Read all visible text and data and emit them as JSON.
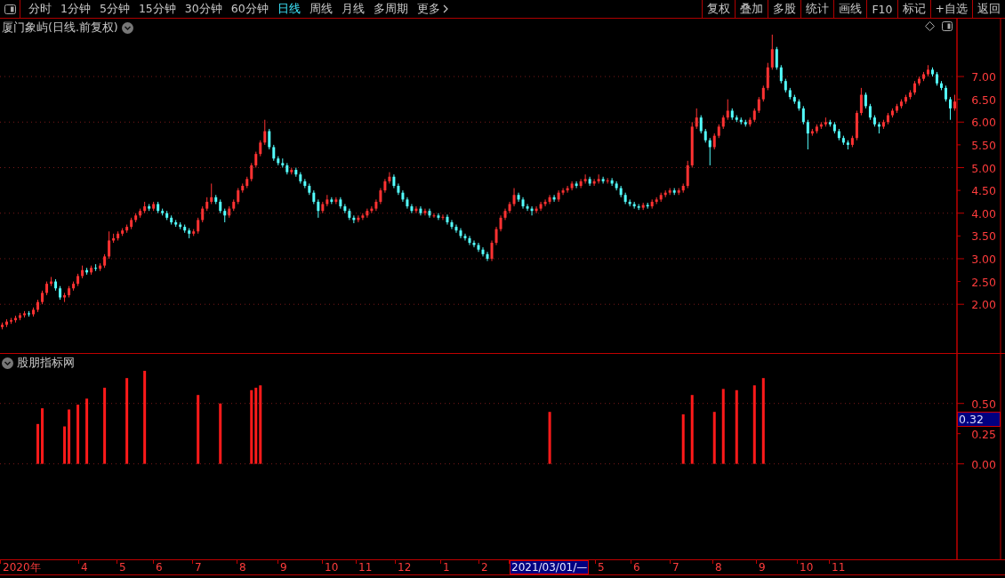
{
  "toolbar": {
    "periods": [
      {
        "label": "分时",
        "selected": false
      },
      {
        "label": "1分钟",
        "selected": false
      },
      {
        "label": "5分钟",
        "selected": false
      },
      {
        "label": "15分钟",
        "selected": false
      },
      {
        "label": "30分钟",
        "selected": false
      },
      {
        "label": "60分钟",
        "selected": false
      },
      {
        "label": "日线",
        "selected": true
      },
      {
        "label": "周线",
        "selected": false
      },
      {
        "label": "月线",
        "selected": false
      },
      {
        "label": "多周期",
        "selected": false
      },
      {
        "label": "更多",
        "selected": false
      }
    ],
    "buttons": [
      "复权",
      "叠加",
      "多股",
      "统计",
      "画线",
      "F10",
      "标记",
      "+自选",
      "返回"
    ]
  },
  "price_panel": {
    "title": "厦门象屿(日线.前复权)",
    "chart_data": {
      "type": "candlestick",
      "ylim": [
        0.93,
        8.27
      ],
      "grid": true,
      "yticks": [
        {
          "value": 7,
          "label": "7.00"
        },
        {
          "value": 6.5,
          "label": "6.50"
        },
        {
          "value": 6,
          "label": "6.00"
        },
        {
          "value": 5.5,
          "label": "5.50"
        },
        {
          "value": 5,
          "label": "5.00"
        },
        {
          "value": 4.5,
          "label": "4.50"
        },
        {
          "value": 4,
          "label": "4.00"
        },
        {
          "value": 3.5,
          "label": "3.50"
        },
        {
          "value": 3,
          "label": "3.00"
        },
        {
          "value": 2.5,
          "label": "2.50"
        },
        {
          "value": 2,
          "label": "2.00"
        }
      ],
      "ohlc": [
        [
          1.5,
          1.6,
          1.45,
          1.55
        ],
        [
          1.55,
          1.67,
          1.5,
          1.62
        ],
        [
          1.62,
          1.7,
          1.57,
          1.65
        ],
        [
          1.65,
          1.75,
          1.6,
          1.7
        ],
        [
          1.7,
          1.81,
          1.65,
          1.76
        ],
        [
          1.76,
          1.85,
          1.71,
          1.8
        ],
        [
          1.8,
          1.85,
          1.73,
          1.78
        ],
        [
          1.78,
          1.93,
          1.73,
          1.88
        ],
        [
          1.88,
          2.1,
          1.83,
          2.05
        ],
        [
          2.05,
          2.3,
          2.0,
          2.25
        ],
        [
          2.25,
          2.5,
          2.2,
          2.45
        ],
        [
          2.45,
          2.6,
          2.4,
          2.5
        ],
        [
          2.5,
          2.55,
          2.3,
          2.35
        ],
        [
          2.35,
          2.4,
          2.1,
          2.15
        ],
        [
          2.15,
          2.25,
          2.05,
          2.2
        ],
        [
          2.2,
          2.4,
          2.15,
          2.35
        ],
        [
          2.35,
          2.5,
          2.3,
          2.45
        ],
        [
          2.45,
          2.67,
          2.4,
          2.62
        ],
        [
          2.62,
          2.85,
          2.57,
          2.75
        ],
        [
          2.75,
          2.8,
          2.65,
          2.7
        ],
        [
          2.7,
          2.85,
          2.65,
          2.8
        ],
        [
          2.8,
          2.88,
          2.73,
          2.78
        ],
        [
          2.78,
          2.9,
          2.73,
          2.85
        ],
        [
          2.85,
          3.1,
          2.8,
          3.05
        ],
        [
          3.05,
          3.6,
          3.0,
          3.4
        ],
        [
          3.4,
          3.55,
          3.35,
          3.45
        ],
        [
          3.45,
          3.6,
          3.4,
          3.55
        ],
        [
          3.55,
          3.67,
          3.5,
          3.62
        ],
        [
          3.62,
          3.75,
          3.57,
          3.7
        ],
        [
          3.7,
          3.9,
          3.65,
          3.85
        ],
        [
          3.85,
          4.0,
          3.8,
          3.95
        ],
        [
          3.95,
          4.1,
          3.9,
          4.05
        ],
        [
          4.05,
          4.25,
          4.0,
          4.15
        ],
        [
          4.15,
          4.2,
          4.05,
          4.1
        ],
        [
          4.1,
          4.25,
          4.05,
          4.2
        ],
        [
          4.2,
          4.25,
          4.0,
          4.05
        ],
        [
          4.05,
          4.1,
          3.95,
          4.0
        ],
        [
          4.0,
          4.05,
          3.85,
          3.9
        ],
        [
          3.9,
          3.95,
          3.75,
          3.8
        ],
        [
          3.8,
          3.85,
          3.7,
          3.75
        ],
        [
          3.75,
          3.8,
          3.65,
          3.7
        ],
        [
          3.7,
          3.75,
          3.57,
          3.62
        ],
        [
          3.62,
          3.67,
          3.45,
          3.55
        ],
        [
          3.55,
          3.65,
          3.5,
          3.6
        ],
        [
          3.6,
          3.9,
          3.55,
          3.85
        ],
        [
          3.85,
          4.15,
          3.8,
          4.1
        ],
        [
          4.1,
          4.35,
          4.05,
          4.25
        ],
        [
          4.25,
          4.65,
          4.2,
          4.35
        ],
        [
          4.35,
          4.4,
          4.2,
          4.25
        ],
        [
          4.25,
          4.3,
          4.0,
          4.05
        ],
        [
          4.05,
          4.1,
          3.8,
          3.95
        ],
        [
          3.95,
          4.15,
          3.9,
          4.1
        ],
        [
          4.1,
          4.3,
          4.05,
          4.25
        ],
        [
          4.25,
          4.55,
          4.2,
          4.5
        ],
        [
          4.5,
          4.65,
          4.45,
          4.6
        ],
        [
          4.6,
          4.8,
          4.55,
          4.75
        ],
        [
          4.75,
          5.1,
          4.7,
          5.05
        ],
        [
          5.05,
          5.35,
          5.0,
          5.3
        ],
        [
          5.3,
          5.6,
          5.25,
          5.55
        ],
        [
          5.55,
          6.05,
          5.5,
          5.8
        ],
        [
          5.8,
          5.85,
          5.4,
          5.45
        ],
        [
          5.45,
          5.5,
          5.15,
          5.2
        ],
        [
          5.2,
          5.25,
          5.05,
          5.1
        ],
        [
          5.1,
          5.2,
          5.0,
          5.05
        ],
        [
          5.05,
          5.1,
          4.85,
          4.9
        ],
        [
          4.9,
          5.0,
          4.85,
          4.95
        ],
        [
          4.95,
          5.0,
          4.8,
          4.85
        ],
        [
          4.85,
          4.9,
          4.65,
          4.7
        ],
        [
          4.7,
          4.75,
          4.55,
          4.6
        ],
        [
          4.6,
          4.65,
          4.4,
          4.45
        ],
        [
          4.45,
          4.5,
          4.2,
          4.25
        ],
        [
          4.25,
          4.3,
          3.9,
          4.05
        ],
        [
          4.05,
          4.25,
          4.0,
          4.2
        ],
        [
          4.2,
          4.4,
          4.15,
          4.3
        ],
        [
          4.3,
          4.35,
          4.2,
          4.25
        ],
        [
          4.25,
          4.35,
          4.2,
          4.3
        ],
        [
          4.3,
          4.35,
          4.1,
          4.15
        ],
        [
          4.15,
          4.2,
          4.0,
          4.05
        ],
        [
          4.05,
          4.1,
          3.85,
          3.9
        ],
        [
          3.9,
          3.95,
          3.78,
          3.85
        ],
        [
          3.85,
          3.95,
          3.8,
          3.9
        ],
        [
          3.9,
          4.0,
          3.85,
          3.95
        ],
        [
          3.95,
          4.1,
          3.9,
          4.05
        ],
        [
          4.05,
          4.15,
          4.0,
          4.1
        ],
        [
          4.1,
          4.3,
          4.05,
          4.25
        ],
        [
          4.25,
          4.55,
          4.2,
          4.5
        ],
        [
          4.5,
          4.75,
          4.45,
          4.7
        ],
        [
          4.7,
          4.9,
          4.65,
          4.8
        ],
        [
          4.8,
          4.85,
          4.55,
          4.6
        ],
        [
          4.6,
          4.65,
          4.4,
          4.45
        ],
        [
          4.45,
          4.5,
          4.25,
          4.3
        ],
        [
          4.3,
          4.35,
          4.1,
          4.15
        ],
        [
          4.15,
          4.2,
          4.0,
          4.05
        ],
        [
          4.05,
          4.15,
          4.0,
          4.1
        ],
        [
          4.1,
          4.15,
          3.95,
          4.0
        ],
        [
          4.0,
          4.1,
          3.95,
          4.05
        ],
        [
          4.05,
          4.1,
          3.9,
          3.95
        ],
        [
          3.95,
          4.0,
          3.9,
          3.95
        ],
        [
          3.95,
          4.0,
          3.85,
          3.9
        ],
        [
          3.9,
          3.97,
          3.85,
          3.92
        ],
        [
          3.92,
          3.97,
          3.75,
          3.8
        ],
        [
          3.8,
          3.85,
          3.65,
          3.7
        ],
        [
          3.7,
          3.75,
          3.57,
          3.62
        ],
        [
          3.62,
          3.67,
          3.45,
          3.5
        ],
        [
          3.5,
          3.55,
          3.4,
          3.45
        ],
        [
          3.45,
          3.5,
          3.3,
          3.35
        ],
        [
          3.35,
          3.4,
          3.25,
          3.3
        ],
        [
          3.3,
          3.35,
          3.15,
          3.2
        ],
        [
          3.2,
          3.25,
          3.05,
          3.1
        ],
        [
          3.1,
          3.15,
          2.95,
          3.0
        ],
        [
          3.0,
          3.4,
          2.95,
          3.35
        ],
        [
          3.35,
          3.7,
          3.3,
          3.65
        ],
        [
          3.65,
          3.95,
          3.6,
          3.9
        ],
        [
          3.9,
          4.1,
          3.85,
          4.05
        ],
        [
          4.05,
          4.25,
          4.0,
          4.2
        ],
        [
          4.2,
          4.55,
          4.15,
          4.4
        ],
        [
          4.4,
          4.45,
          4.25,
          4.3
        ],
        [
          4.3,
          4.35,
          4.1,
          4.15
        ],
        [
          4.15,
          4.2,
          4.05,
          4.1
        ],
        [
          4.1,
          4.15,
          3.95,
          4.05
        ],
        [
          4.05,
          4.15,
          4.0,
          4.1
        ],
        [
          4.1,
          4.25,
          4.05,
          4.2
        ],
        [
          4.2,
          4.3,
          4.15,
          4.25
        ],
        [
          4.25,
          4.4,
          4.2,
          4.35
        ],
        [
          4.35,
          4.4,
          4.25,
          4.3
        ],
        [
          4.3,
          4.5,
          4.25,
          4.45
        ],
        [
          4.45,
          4.55,
          4.4,
          4.5
        ],
        [
          4.5,
          4.6,
          4.45,
          4.55
        ],
        [
          4.55,
          4.7,
          4.5,
          4.65
        ],
        [
          4.65,
          4.7,
          4.55,
          4.6
        ],
        [
          4.6,
          4.75,
          4.55,
          4.7
        ],
        [
          4.7,
          4.85,
          4.65,
          4.75
        ],
        [
          4.75,
          4.8,
          4.6,
          4.65
        ],
        [
          4.65,
          4.75,
          4.6,
          4.7
        ],
        [
          4.7,
          4.85,
          4.65,
          4.75
        ],
        [
          4.75,
          4.8,
          4.65,
          4.7
        ],
        [
          4.7,
          4.77,
          4.65,
          4.72
        ],
        [
          4.72,
          4.77,
          4.6,
          4.65
        ],
        [
          4.65,
          4.7,
          4.5,
          4.55
        ],
        [
          4.55,
          4.6,
          4.35,
          4.4
        ],
        [
          4.4,
          4.45,
          4.2,
          4.25
        ],
        [
          4.25,
          4.3,
          4.15,
          4.2
        ],
        [
          4.2,
          4.25,
          4.1,
          4.15
        ],
        [
          4.15,
          4.2,
          4.07,
          4.12
        ],
        [
          4.12,
          4.23,
          4.07,
          4.18
        ],
        [
          4.18,
          4.23,
          4.1,
          4.15
        ],
        [
          4.15,
          4.3,
          4.1,
          4.25
        ],
        [
          4.25,
          4.35,
          4.2,
          4.3
        ],
        [
          4.3,
          4.45,
          4.25,
          4.4
        ],
        [
          4.4,
          4.5,
          4.35,
          4.45
        ],
        [
          4.45,
          4.55,
          4.4,
          4.5
        ],
        [
          4.5,
          4.55,
          4.4,
          4.45
        ],
        [
          4.45,
          4.55,
          4.4,
          4.5
        ],
        [
          4.5,
          4.65,
          4.45,
          4.6
        ],
        [
          4.6,
          5.15,
          4.55,
          5.05
        ],
        [
          5.05,
          6.0,
          5.0,
          5.9
        ],
        [
          5.9,
          6.3,
          5.85,
          6.1
        ],
        [
          6.1,
          6.15,
          5.75,
          5.8
        ],
        [
          5.8,
          5.85,
          5.55,
          5.6
        ],
        [
          5.6,
          5.65,
          5.05,
          5.45
        ],
        [
          5.45,
          5.75,
          5.4,
          5.7
        ],
        [
          5.7,
          5.95,
          5.65,
          5.9
        ],
        [
          5.9,
          6.15,
          5.85,
          6.1
        ],
        [
          6.1,
          6.5,
          6.05,
          6.25
        ],
        [
          6.25,
          6.3,
          6.05,
          6.1
        ],
        [
          6.1,
          6.15,
          6.0,
          6.05
        ],
        [
          6.05,
          6.1,
          5.95,
          6.0
        ],
        [
          6.0,
          6.05,
          5.9,
          5.95
        ],
        [
          5.95,
          6.1,
          5.9,
          6.05
        ],
        [
          6.05,
          6.3,
          6.0,
          6.25
        ],
        [
          6.25,
          6.55,
          6.2,
          6.5
        ],
        [
          6.5,
          6.8,
          6.45,
          6.75
        ],
        [
          6.75,
          7.3,
          6.7,
          7.2
        ],
        [
          7.2,
          7.92,
          7.15,
          7.6
        ],
        [
          7.6,
          7.65,
          7.15,
          7.2
        ],
        [
          7.2,
          7.25,
          6.85,
          6.9
        ],
        [
          6.9,
          6.95,
          6.65,
          6.7
        ],
        [
          6.7,
          6.75,
          6.5,
          6.55
        ],
        [
          6.55,
          6.6,
          6.4,
          6.45
        ],
        [
          6.45,
          6.5,
          6.25,
          6.3
        ],
        [
          6.3,
          6.35,
          5.95,
          6.0
        ],
        [
          6.0,
          6.05,
          5.4,
          5.75
        ],
        [
          5.75,
          5.85,
          5.7,
          5.8
        ],
        [
          5.8,
          5.95,
          5.75,
          5.9
        ],
        [
          5.9,
          6.0,
          5.85,
          5.95
        ],
        [
          5.95,
          6.1,
          5.9,
          6.0
        ],
        [
          6.0,
          6.05,
          5.9,
          5.95
        ],
        [
          5.95,
          6.0,
          5.75,
          5.8
        ],
        [
          5.8,
          5.85,
          5.6,
          5.65
        ],
        [
          5.65,
          5.7,
          5.5,
          5.55
        ],
        [
          5.55,
          5.6,
          5.4,
          5.5
        ],
        [
          5.5,
          5.7,
          5.45,
          5.65
        ],
        [
          5.65,
          6.25,
          5.6,
          6.2
        ],
        [
          6.2,
          6.75,
          6.15,
          6.6
        ],
        [
          6.6,
          6.65,
          6.3,
          6.35
        ],
        [
          6.35,
          6.4,
          6.05,
          6.1
        ],
        [
          6.1,
          6.15,
          5.9,
          5.95
        ],
        [
          5.95,
          6.0,
          5.75,
          5.9
        ],
        [
          5.9,
          6.05,
          5.85,
          6.0
        ],
        [
          6.0,
          6.2,
          5.95,
          6.15
        ],
        [
          6.15,
          6.3,
          6.1,
          6.25
        ],
        [
          6.25,
          6.4,
          6.2,
          6.35
        ],
        [
          6.35,
          6.5,
          6.3,
          6.45
        ],
        [
          6.45,
          6.6,
          6.4,
          6.55
        ],
        [
          6.55,
          6.7,
          6.5,
          6.65
        ],
        [
          6.65,
          6.9,
          6.6,
          6.85
        ],
        [
          6.85,
          7.0,
          6.8,
          6.95
        ],
        [
          6.95,
          7.1,
          6.9,
          7.05
        ],
        [
          7.05,
          7.25,
          7.0,
          7.15
        ],
        [
          7.15,
          7.2,
          7.0,
          7.05
        ],
        [
          7.05,
          7.1,
          6.8,
          6.85
        ],
        [
          6.85,
          6.9,
          6.7,
          6.75
        ],
        [
          6.75,
          6.8,
          6.45,
          6.5
        ],
        [
          6.5,
          6.55,
          6.05,
          6.3
        ],
        [
          6.3,
          6.6,
          6.25,
          6.45
        ]
      ]
    }
  },
  "indicator_panel": {
    "title": "股朋指标网",
    "current_value": "0.32",
    "chart_data": {
      "type": "bar",
      "ylim": [
        -0.79,
        0.91
      ],
      "grid": true,
      "yticks": [
        {
          "value": 0.5,
          "label": "0.50"
        },
        {
          "value": 0.25,
          "label": "0.25"
        },
        {
          "value": 0,
          "label": "0.00"
        }
      ],
      "values": [
        null,
        null,
        null,
        null,
        null,
        null,
        null,
        null,
        0.33,
        0.46,
        null,
        null,
        null,
        null,
        0.31,
        0.45,
        null,
        0.49,
        null,
        0.54,
        null,
        null,
        null,
        0.63,
        null,
        null,
        null,
        null,
        0.71,
        null,
        null,
        null,
        0.77,
        null,
        null,
        null,
        null,
        null,
        null,
        null,
        null,
        null,
        null,
        null,
        0.57,
        null,
        null,
        null,
        null,
        0.5,
        null,
        null,
        null,
        null,
        null,
        null,
        0.61,
        0.63,
        0.65,
        null,
        null,
        null,
        null,
        null,
        null,
        null,
        null,
        null,
        null,
        null,
        null,
        null,
        null,
        null,
        null,
        null,
        null,
        null,
        null,
        null,
        null,
        null,
        null,
        null,
        null,
        null,
        null,
        null,
        null,
        null,
        null,
        null,
        null,
        null,
        null,
        null,
        null,
        null,
        null,
        null,
        null,
        null,
        null,
        null,
        null,
        null,
        null,
        null,
        null,
        null,
        null,
        null,
        null,
        null,
        null,
        null,
        null,
        null,
        null,
        null,
        null,
        null,
        null,
        0.43,
        null,
        null,
        null,
        null,
        null,
        null,
        null,
        null,
        null,
        null,
        null,
        null,
        null,
        null,
        null,
        null,
        null,
        null,
        null,
        null,
        null,
        null,
        null,
        null,
        null,
        null,
        null,
        null,
        null,
        0.41,
        null,
        0.57,
        null,
        null,
        null,
        null,
        0.43,
        null,
        0.62,
        null,
        null,
        0.61,
        null,
        null,
        null,
        0.65,
        null,
        0.71,
        null,
        null,
        null,
        null,
        null,
        null,
        null,
        null,
        null,
        null,
        null,
        null,
        null,
        null,
        null,
        null,
        null,
        null,
        null,
        null,
        null,
        null,
        null,
        null,
        null,
        null,
        null,
        null,
        null,
        null,
        null,
        null,
        null,
        null,
        null,
        null,
        null,
        null,
        null,
        null,
        null,
        null,
        null
      ]
    }
  },
  "time_axis": {
    "labels": [
      {
        "label": "2020年",
        "selected": false
      },
      {
        "label": "4",
        "selected": false
      },
      {
        "label": "5",
        "selected": false
      },
      {
        "label": "6",
        "selected": false
      },
      {
        "label": "7",
        "selected": false
      },
      {
        "label": "8",
        "selected": false
      },
      {
        "label": "9",
        "selected": false
      },
      {
        "label": "10",
        "selected": false
      },
      {
        "label": "11",
        "selected": false
      },
      {
        "label": "12",
        "selected": false
      },
      {
        "label": "1",
        "selected": false
      },
      {
        "label": "2",
        "selected": false
      },
      {
        "label": "2021/03/01/—",
        "selected": true
      },
      {
        "label": "5",
        "selected": false
      },
      {
        "label": "6",
        "selected": false
      },
      {
        "label": "7",
        "selected": false
      },
      {
        "label": "8",
        "selected": false
      },
      {
        "label": "9",
        "selected": false
      },
      {
        "label": "10",
        "selected": false
      },
      {
        "label": "11",
        "selected": false
      }
    ]
  }
}
